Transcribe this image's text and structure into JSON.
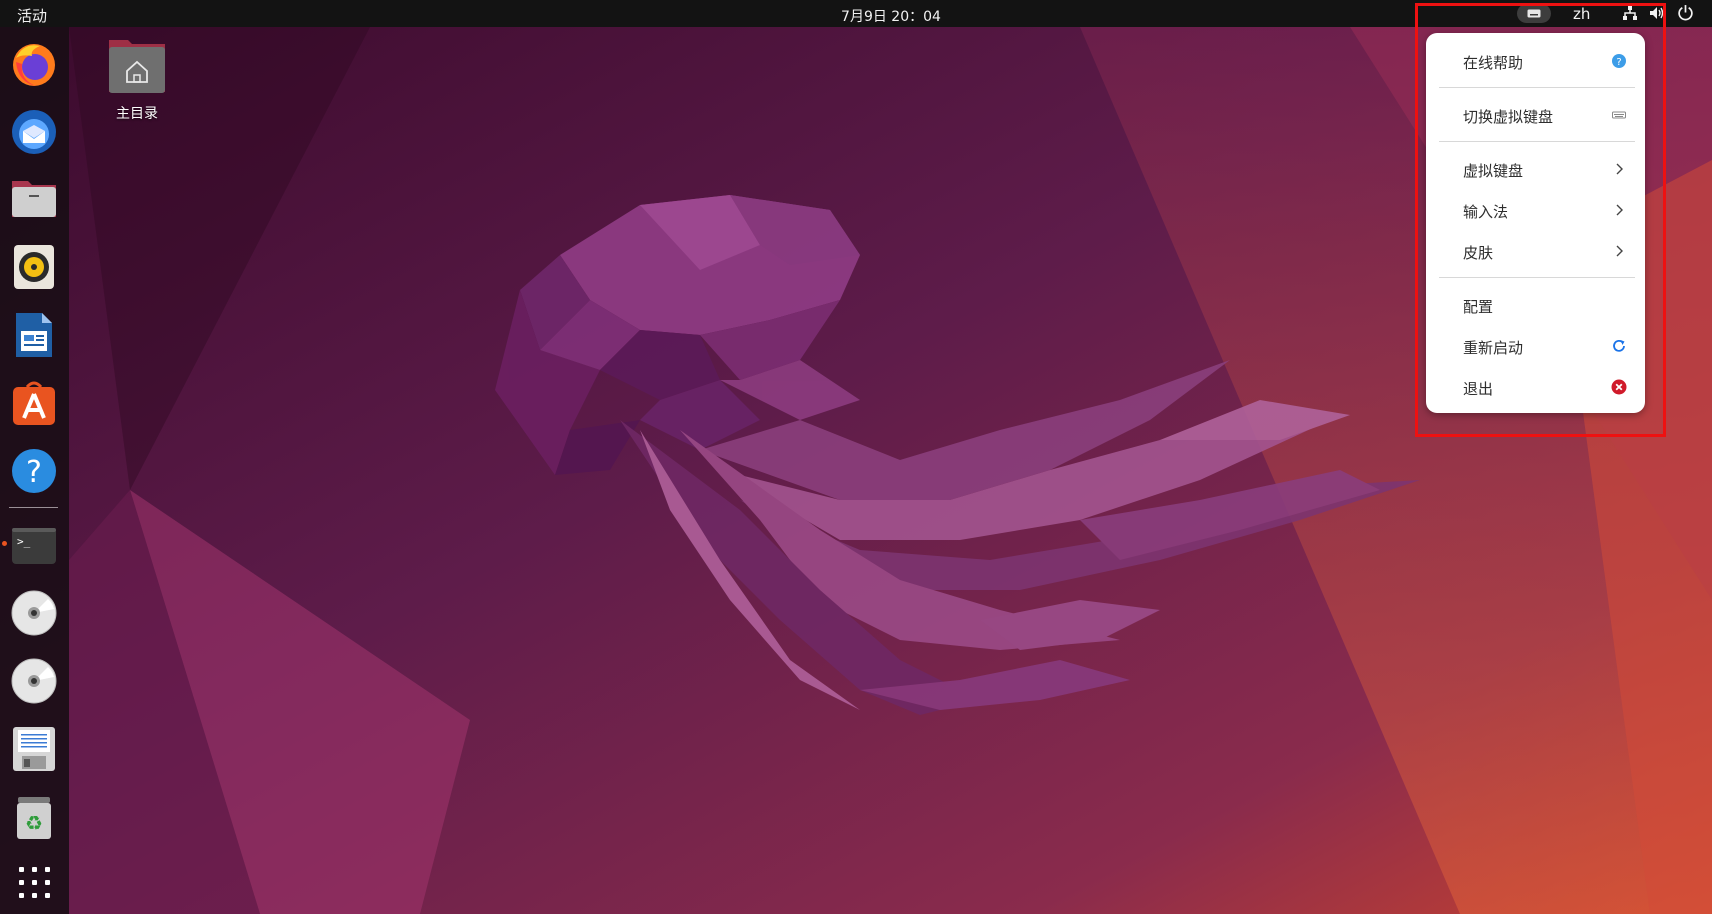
{
  "topbar": {
    "activities": "活动",
    "clock": "7月9日 20：04",
    "input_language": "zh"
  },
  "desktop": {
    "home_folder_label": "主目录"
  },
  "dock": {
    "apps": [
      "firefox",
      "thunderbird",
      "files",
      "rhythmbox",
      "libreoffice-writer",
      "app-center",
      "help",
      "terminal",
      "disc-1",
      "disc-2",
      "floppy-document",
      "trash",
      "show-apps"
    ]
  },
  "menu": {
    "items": [
      {
        "label": "在线帮助",
        "icon": "help-circle-icon"
      },
      {
        "label": "切换虚拟键盘",
        "icon": "keyboard-icon"
      },
      {
        "label": "虚拟键盘",
        "icon": "chevron-right-icon"
      },
      {
        "label": "输入法",
        "icon": "chevron-right-icon"
      },
      {
        "label": "皮肤",
        "icon": "chevron-right-icon"
      },
      {
        "label": "配置",
        "icon": ""
      },
      {
        "label": "重新启动",
        "icon": "refresh-icon"
      },
      {
        "label": "退出",
        "icon": "close-circle-icon"
      }
    ]
  },
  "colors": {
    "topbar": "#131313",
    "accent": "#e95420",
    "highlight_frame": "#ee1111",
    "help_icon": "#3d9de8",
    "refresh_icon": "#1a73e8",
    "exit_icon": "#d01a2a"
  }
}
